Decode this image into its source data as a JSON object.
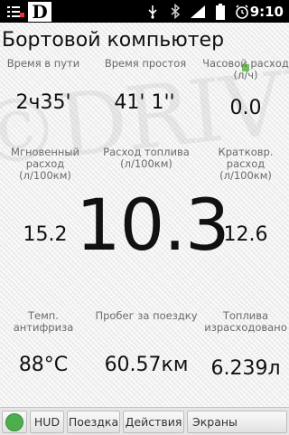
{
  "status_bar": {
    "time": "9:10"
  },
  "header": {
    "title": "Бортовой компьютер"
  },
  "metrics": {
    "travel_time": {
      "label": "Время в пути",
      "value": "2ч35'"
    },
    "idle_time": {
      "label": "Время простоя",
      "value": "41' 1''"
    },
    "hourly_rate": {
      "label": "Часовой расход (л/ч)",
      "value": "0.0"
    },
    "instant_rate": {
      "label": "Мгновенный расход (л/100км)",
      "value": "15.2"
    },
    "fuel_rate": {
      "label": "Расход топлива (л/100км)",
      "value": "10.3"
    },
    "short_term_rate": {
      "label": "Кратковр. расход (л/100км)",
      "value": "12.6"
    },
    "coolant_temp": {
      "label": "Темп. антифриза",
      "value": "88°C"
    },
    "trip_distance": {
      "label": "Пробег за поездку",
      "value": "60.57км"
    },
    "fuel_used": {
      "label": "Топлива израсходовано",
      "value": "6.239л"
    }
  },
  "tabs": [
    {
      "label": "HUD"
    },
    {
      "label": "Поездка"
    },
    {
      "label": "Действия"
    },
    {
      "label": "Экраны"
    }
  ],
  "colors": {
    "accent_green": "#4cae4c",
    "status_bar_bg": "#000000"
  },
  "icons": [
    "app-logo-icon",
    "usb-icon",
    "bluetooth-icon",
    "signal-icon",
    "battery-icon",
    "alarm-icon",
    "status-icon"
  ]
}
